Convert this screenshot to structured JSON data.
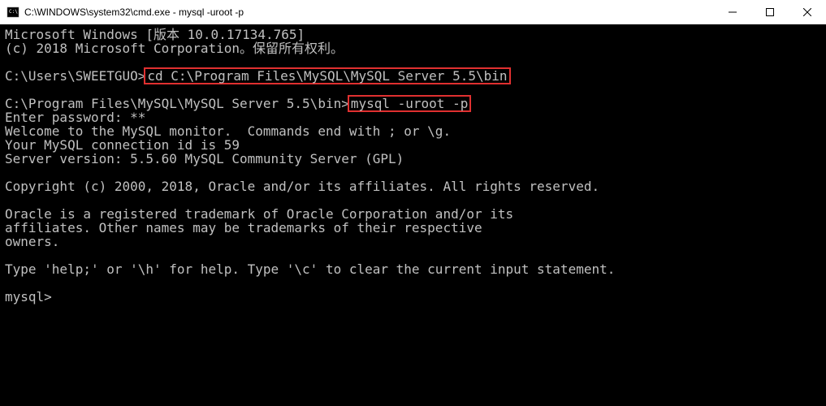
{
  "titlebar": {
    "text": "C:\\WINDOWS\\system32\\cmd.exe - mysql  -uroot -p"
  },
  "terminal": {
    "line1": "Microsoft Windows [版本 10.0.17134.765]",
    "line2": "(c) 2018 Microsoft Corporation。保留所有权利。",
    "line3": "",
    "line4_prompt": "C:\\Users\\SWEETGUO>",
    "line4_cmd": "cd C:\\Program Files\\MySQL\\MySQL Server 5.5\\bin",
    "line5": "",
    "line6_prompt": "C:\\Program Files\\MySQL\\MySQL Server 5.5\\bin>",
    "line6_cmd": "mysql -uroot -p",
    "line7": "Enter password: **",
    "line8": "Welcome to the MySQL monitor.  Commands end with ; or \\g.",
    "line9": "Your MySQL connection id is 59",
    "line10": "Server version: 5.5.60 MySQL Community Server (GPL)",
    "line11": "",
    "line12": "Copyright (c) 2000, 2018, Oracle and/or its affiliates. All rights reserved.",
    "line13": "",
    "line14": "Oracle is a registered trademark of Oracle Corporation and/or its",
    "line15": "affiliates. Other names may be trademarks of their respective",
    "line16": "owners.",
    "line17": "",
    "line18": "Type 'help;' or '\\h' for help. Type '\\c' to clear the current input statement.",
    "line19": "",
    "line20": "mysql>"
  }
}
